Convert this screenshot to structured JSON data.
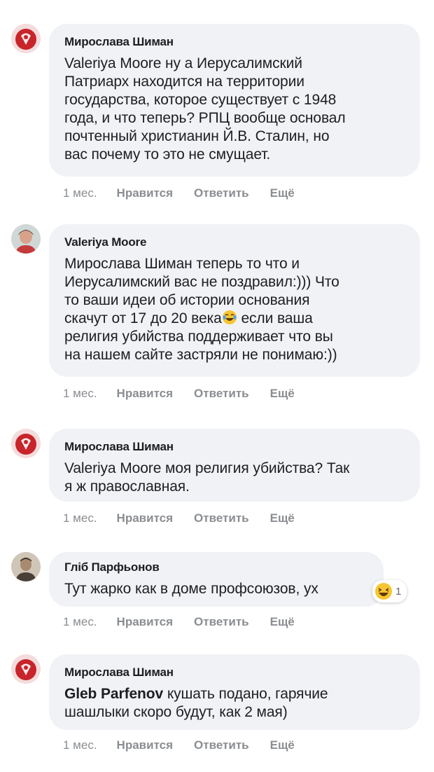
{
  "comments": [
    {
      "author": "Мирослава Шиман",
      "avatar": "red-avatar-icon",
      "text": "Valeriya Moore ну а Иерусалимский\nПатриарх находится на территории\nгосударства, которое существует с 1948\nгода, и что теперь? РПЦ вообще основал\nпочтенный христианин Й.В. Сталин, но\nвас почему то это не смущает.",
      "time": "1 мес.",
      "like": "Нравится",
      "reply": "Ответить",
      "more": "Ещё"
    },
    {
      "author": "Valeriya Moore",
      "avatar": "portrait-avatar-icon",
      "text_before_emoji": "Мирослава Шиман теперь то что и\nИерусалимский вас не поздравил:))) Что\nто ваши идеи об истории основания\nскачут от 17 до 20 века",
      "emoji": "crying-laughing-emoji-icon",
      "text_after_emoji": " если ваша\nрелигия убийства поддерживает что вы\nна нашем сайте застряли не понимаю:))",
      "time": "1 мес.",
      "like": "Нравится",
      "reply": "Ответить",
      "more": "Ещё"
    },
    {
      "author": "Мирослава Шиман",
      "avatar": "red-avatar-icon",
      "text": "Valeriya Moore моя религия убийства? Так\nя ж православная.",
      "time": "1 мес.",
      "like": "Нравится",
      "reply": "Ответить",
      "more": "Ещё"
    },
    {
      "author": "Гліб Парфьонов",
      "avatar": "man-portrait-avatar-icon",
      "text": "Тут жарко как в доме профсоюзов, ух",
      "reaction": {
        "icon": "haha-reaction-icon",
        "count": "1"
      },
      "time": "1 мес.",
      "like": "Нравится",
      "reply": "Ответить",
      "more": "Ещё"
    },
    {
      "author": "Мирослава Шиман",
      "avatar": "red-avatar-icon",
      "mention": "Gleb Parfenov",
      "text": " кушать подано, гарячие\nшашлыки скоро будут, как 2 мая)",
      "time": "1 мес.",
      "like": "Нравится",
      "reply": "Ответить",
      "more": "Ещё"
    }
  ],
  "colors": {
    "bubble": "#f0f2f5",
    "text": "#1c1e21",
    "meta": "#8a8d91",
    "emoji_yellow": "#f7c533"
  }
}
